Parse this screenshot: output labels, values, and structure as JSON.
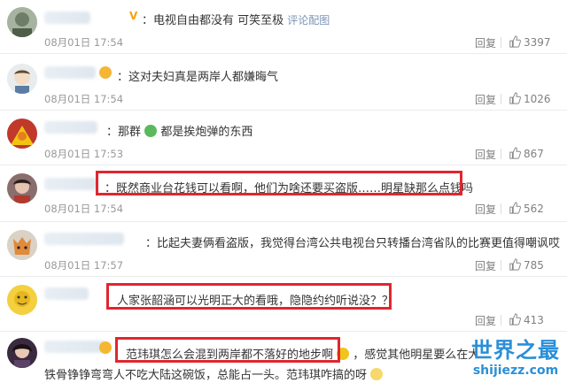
{
  "comments": [
    {
      "text": "电视自由都没有 可笑至极",
      "link": "评论配图",
      "time": "08月01日 17:54",
      "reply": "回复",
      "likes": "3397"
    },
    {
      "text": "这对夫妇真是两岸人都嫌晦气",
      "time": "08月01日 17:54",
      "reply": "回复",
      "likes": "1026"
    },
    {
      "text": "那群",
      "text2": "都是挨炮弹的东西",
      "time": "08月01日 17:53",
      "reply": "回复",
      "likes": "867"
    },
    {
      "text": "：既然商业台花钱可以看啊，他们为啥还要买盗版……明星缺那么点钱吗",
      "time": "08月01日 17:54",
      "reply": "回复",
      "likes": "562"
    },
    {
      "text": "比起夫妻俩看盗版，我觉得台湾公共电视台只转播台湾省队的比赛更值得嘲讽哎",
      "time": "08月01日 17:57",
      "reply": "回复",
      "likes": "785"
    },
    {
      "text": "人家张韶涵可以光明正大的看哦，隐隐约约听说没？？",
      "reply": "回复",
      "likes": "413"
    },
    {
      "text": "范玮琪怎么会混到两岸都不落好的地步啊",
      "text2": "，感觉其他明星要么在大",
      "line2": "铁骨铮铮弯弯人不吃大陆这碗饭，总能占一头。范玮琪咋搞的呀"
    }
  ],
  "watermark": {
    "title": "世界之最",
    "url": "shijiezz.com"
  },
  "colors": {
    "highlight": "#e0262f",
    "link": "#7a94b6",
    "meta": "#999999",
    "watermark": "#2a8fd8"
  }
}
